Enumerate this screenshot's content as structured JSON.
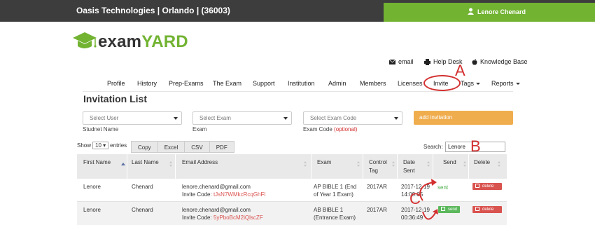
{
  "header": {
    "org": "Oasis Technologies | Orlando | (36003)",
    "user": "Lenore Chenard"
  },
  "logo": {
    "part1": "exam",
    "part2": "YARD"
  },
  "util_links": [
    {
      "label": "email",
      "icon": "envelope-icon"
    },
    {
      "label": "Help Desk",
      "icon": "print-icon"
    },
    {
      "label": "Knowledge Base",
      "icon": "apple-icon"
    }
  ],
  "nav": [
    "Profile",
    "History",
    "Prep-Exams",
    "The Exam",
    "Support",
    "Institution",
    "Admin",
    "Members",
    "Licenses",
    "Invite",
    "Tags",
    "Reports"
  ],
  "annotations": {
    "a": "A",
    "b": "B",
    "c": "C"
  },
  "page_title": "Invitation List",
  "filters": {
    "user_placeholder": "Select User",
    "user_label": "Studnet Name",
    "exam_placeholder": "Select Exam",
    "exam_label": "Exam",
    "code_placeholder": "Select Exam Code",
    "code_label": "Exam Code",
    "code_optional": "(optional)",
    "add_button": "add invitation"
  },
  "table_controls": {
    "show": "Show",
    "entries_value": "10",
    "entries": "entries",
    "export_buttons": [
      "Copy",
      "Excel",
      "CSV",
      "PDF"
    ],
    "search_label": "Search:",
    "search_value": "Lenore"
  },
  "columns": [
    "First Name",
    "Last Name",
    "Email Address",
    "Exam",
    "Control Tag",
    "Date Sent",
    "Send",
    "Delete"
  ],
  "rows": [
    {
      "first": "Lenore",
      "last": "Chenard",
      "email": "lenore.chenard@gmail.com",
      "invite_label": "Invite Code:",
      "invite_code": "tJsN7WMkcRcqGhFl",
      "exam_line1": "AP BIBLE 1 (End",
      "exam_line2": "of Year 1 Exam)",
      "tag": "2017AR",
      "date_line1": "2017-12-19",
      "date_line2": "14:00:05",
      "send": "sent",
      "delete": "delete"
    },
    {
      "first": "Lenore",
      "last": "Chenard",
      "email": "lenore.chenard@gmail.com",
      "invite_label": "Invite Code:",
      "invite_code": "5yPboBcM2iQlscZF",
      "exam_line1": "AB BIBLE 1",
      "exam_line2": "(Entrance Exam)",
      "tag": "2017AR",
      "date_line1": "2017-12-19",
      "date_line2": "00:36:49",
      "send": "send",
      "delete": "delete"
    }
  ]
}
